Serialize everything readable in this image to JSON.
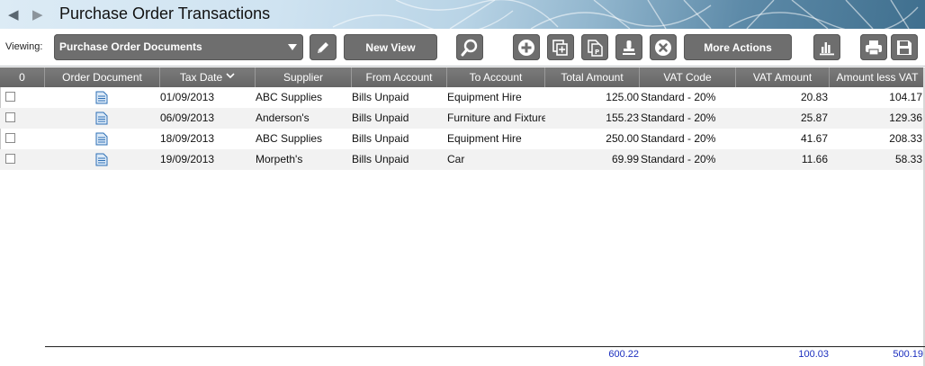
{
  "window": {
    "title": "Purchase Order Transactions",
    "back_icon": "back-arrow-icon",
    "forward_icon": "forward-arrow-icon"
  },
  "toolbar": {
    "viewing_label": "Viewing:",
    "view_selected": "Purchase Order Documents",
    "new_view_label": "New View",
    "more_actions_label": "More Actions",
    "icons": [
      "edit-pencil-icon",
      "search-icon",
      "add-icon",
      "duplicate-icon",
      "document-properties-icon",
      "stamp-icon",
      "delete-icon",
      "chart-icon",
      "print-icon",
      "save-icon"
    ]
  },
  "grid": {
    "columns": [
      {
        "key": "select",
        "label": "0"
      },
      {
        "key": "order_document",
        "label": "Order Document"
      },
      {
        "key": "tax_date",
        "label": "Tax Date",
        "sorted": "descending"
      },
      {
        "key": "supplier",
        "label": "Supplier"
      },
      {
        "key": "from_account",
        "label": "From Account"
      },
      {
        "key": "to_account",
        "label": "To Account"
      },
      {
        "key": "total_amount",
        "label": "Total Amount"
      },
      {
        "key": "vat_code",
        "label": "VAT Code"
      },
      {
        "key": "vat_amount",
        "label": "VAT Amount"
      },
      {
        "key": "amount_less_vat",
        "label": "Amount less VAT"
      }
    ],
    "rows": [
      {
        "tax_date": "01/09/2013",
        "supplier": "ABC Supplies",
        "from_account": "Bills Unpaid",
        "to_account": "Equipment Hire",
        "total_amount": "125.00",
        "vat_code": "Standard - 20%",
        "vat_amount": "20.83",
        "amount_less_vat": "104.17"
      },
      {
        "tax_date": "06/09/2013",
        "supplier": "Anderson's",
        "from_account": "Bills Unpaid",
        "to_account": "Furniture and Fixture",
        "total_amount": "155.23",
        "vat_code": "Standard - 20%",
        "vat_amount": "25.87",
        "amount_less_vat": "129.36"
      },
      {
        "tax_date": "18/09/2013",
        "supplier": "ABC Supplies",
        "from_account": "Bills Unpaid",
        "to_account": "Equipment Hire",
        "total_amount": "250.00",
        "vat_code": "Standard - 20%",
        "vat_amount": "41.67",
        "amount_less_vat": "208.33"
      },
      {
        "tax_date": "19/09/2013",
        "supplier": "Morpeth's",
        "from_account": "Bills Unpaid",
        "to_account": "Car",
        "total_amount": "69.99",
        "vat_code": "Standard - 20%",
        "vat_amount": "11.66",
        "amount_less_vat": "58.33"
      }
    ],
    "totals": {
      "total_amount": "600.22",
      "vat_amount": "100.03",
      "amount_less_vat": "500.19"
    }
  },
  "colors": {
    "toolbar_button": "#6e6e6e",
    "header_bg": "#707070",
    "total_text": "#1c2fbf",
    "document_icon": "#2e6fb5"
  }
}
